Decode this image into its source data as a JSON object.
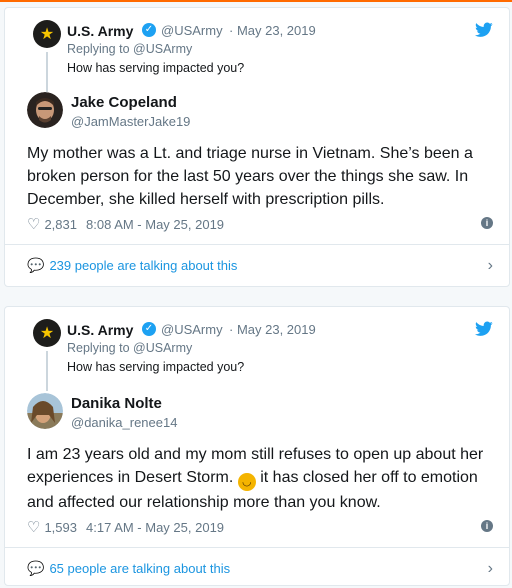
{
  "tweets": [
    {
      "parent": {
        "name": "U.S. Army",
        "handle": "@USArmy",
        "date": "· May 23, 2019",
        "replying": "Replying to @USArmy",
        "text": "How has serving impacted you?"
      },
      "author": {
        "name": "Jake Copeland",
        "handle": "@JamMasterJake19"
      },
      "text": "My mother was a Lt. and triage nurse in Vietnam. She’s been a broken person for the last 50 years over the things she saw. In December, she killed herself with prescription pills.",
      "likes": "2,831",
      "time": "8:08 AM - May 25, 2019",
      "talking": "239 people are talking about this"
    },
    {
      "parent": {
        "name": "U.S. Army",
        "handle": "@USArmy",
        "date": "· May 23, 2019",
        "replying": "Replying to @USArmy",
        "text": "How has serving impacted you?"
      },
      "author": {
        "name": "Danika Nolte",
        "handle": "@danika_renee14"
      },
      "text_before": "I am 23 years old and my mom still refuses to open up about her experiences in Desert Storm.",
      "emoji": "upside-down-face",
      "text_after": "it has closed her off to emotion and affected our relationship more than you know.",
      "likes": "1,593",
      "time": "4:17 AM - May 25, 2019",
      "talking": "65 people are talking about this"
    }
  ],
  "colors": {
    "link": "#1b95e0",
    "verified": "#1da1f2",
    "muted": "#657786",
    "accent_bar": "#ff6a00"
  }
}
